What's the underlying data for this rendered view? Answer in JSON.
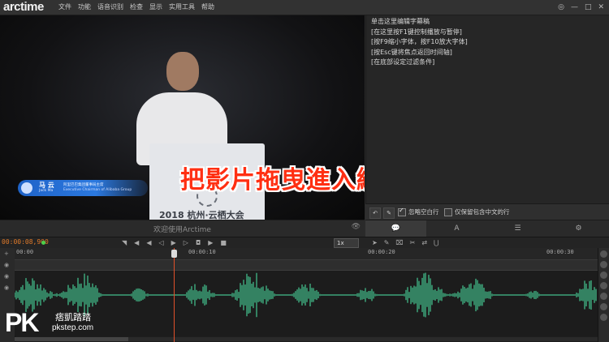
{
  "app": {
    "logo": "arctime"
  },
  "menu": [
    "文件",
    "功能",
    "语音识别",
    "检查",
    "显示",
    "实用工具",
    "帮助"
  ],
  "window_controls": [
    "◎",
    "—",
    "□",
    "✕"
  ],
  "video": {
    "podium_text": "2018 杭州·云栖大会",
    "nameplate": {
      "name": "马  云",
      "name_en": "Jack Ma",
      "title": "阿里巴巴集团董事局主席",
      "title_en": "Executive Chairman of Alibaba Group"
    },
    "overlay_caption": "把影片拖曳進入編輯器"
  },
  "welcome": {
    "text": "欢迎使用Arctime"
  },
  "editor": {
    "lines": [
      "单击这里编辑字幕稿",
      "[在这里按F1键控制播放与暂停]",
      "[按F9缩小字体，按F10放大字体]",
      "[按Esc键将焦点返回时间轴]",
      "[在底部设定过滤条件]"
    ]
  },
  "editor_toolbar": {
    "ignore_blank": {
      "label": "忽略空白行",
      "checked": true
    },
    "keep_chinese": {
      "label": "仅保留包含中文的行",
      "checked": false
    }
  },
  "right_tabs": [
    "💬",
    "A",
    "☰",
    "⚙"
  ],
  "controls": {
    "timecode": "00:00:08,900",
    "speed": "1x",
    "playback_buttons": [
      "◥",
      "◀",
      "◀",
      "▶",
      "▶",
      "▶",
      "▶",
      "⬛",
      "▶",
      "⏹"
    ]
  },
  "timeline": {
    "ruler_labels": [
      "00:00",
      "00:00:10",
      "00:00:20",
      "00:00:30"
    ]
  },
  "watermark": {
    "logo": "PK",
    "cn": "痞凱踏踏",
    "en": "pkstep.com"
  }
}
